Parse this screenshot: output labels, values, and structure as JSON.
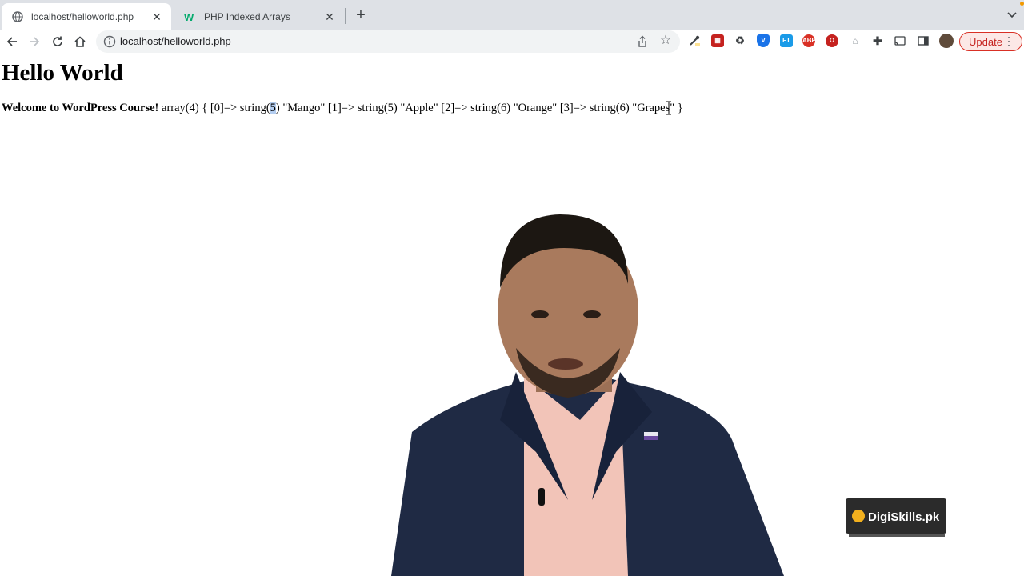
{
  "tabs": [
    {
      "title": "localhost/helloworld.php",
      "active": true,
      "icon": "globe-icon"
    },
    {
      "title": "PHP Indexed Arrays",
      "active": false,
      "icon": "w3schools-icon"
    }
  ],
  "toolbar": {
    "url": "localhost/helloworld.php",
    "update_label": "Update"
  },
  "page": {
    "heading": "Hello World",
    "welcome": "Welcome to WordPress Course!",
    "dump_prefix": "array(4) { [0]=> string(",
    "dump_highlight": "5",
    "dump_rest": ") \"Mango\" [1]=> string(5) \"Apple\" [2]=> string(6) \"Orange\" [3]=> string(6) \"Grapes\" }"
  },
  "overlay": {
    "logo_text": "DigiSkills.pk"
  },
  "colors": {
    "tabstrip_bg": "#dee1e6",
    "update_border": "#d93025",
    "suit": "#1f2a44",
    "shirt": "#f2c4b8"
  }
}
